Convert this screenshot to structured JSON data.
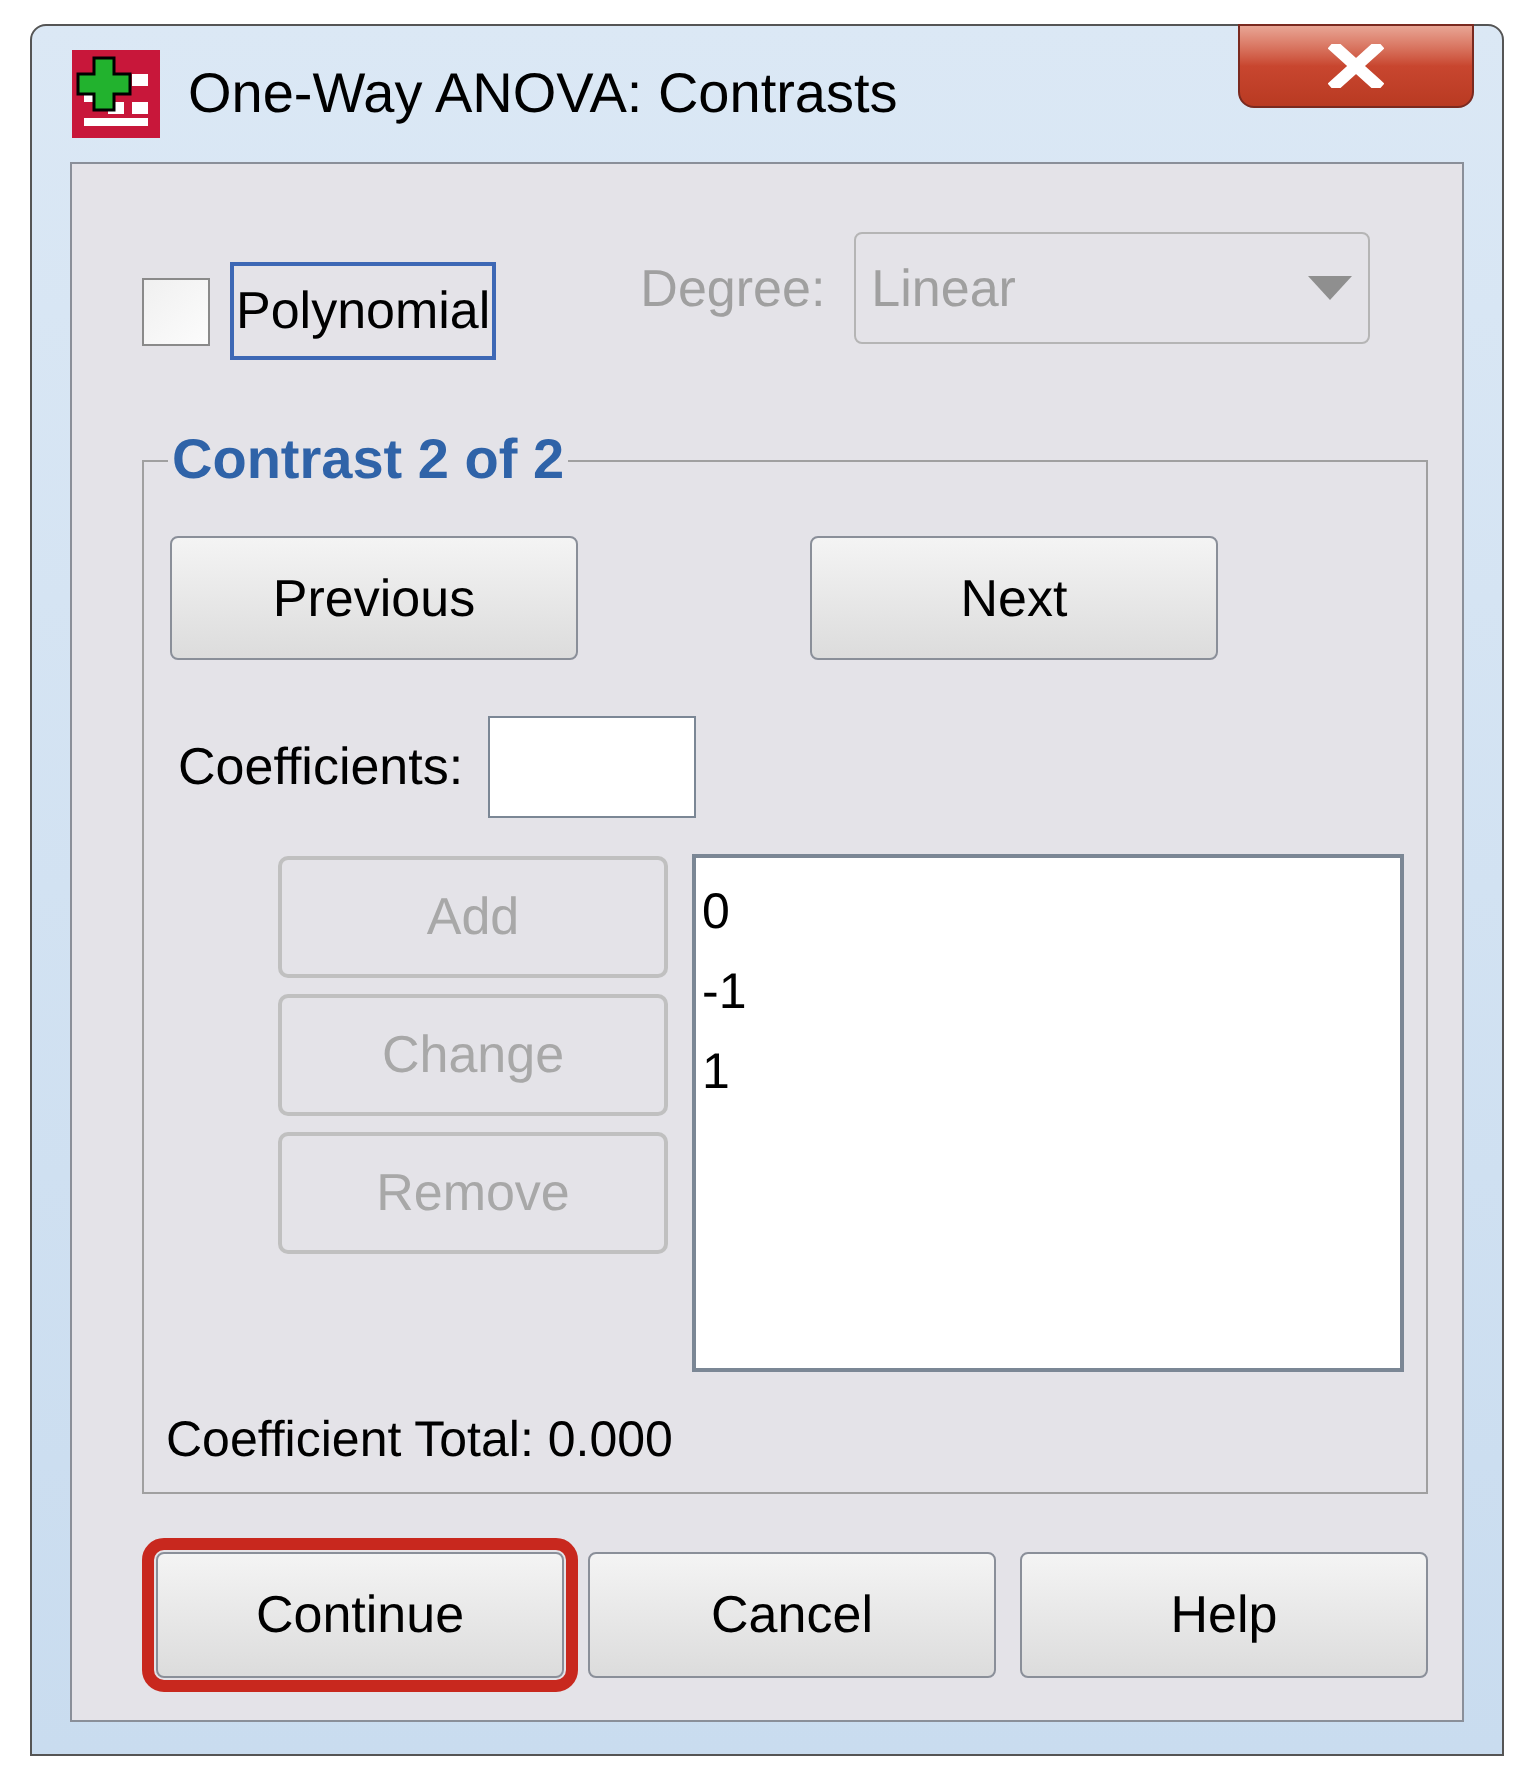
{
  "window": {
    "title": "One-Way ANOVA: Contrasts"
  },
  "polynomial": {
    "label": "Polynomial",
    "checked": false,
    "focused": true
  },
  "degree": {
    "label": "Degree:",
    "value": "Linear",
    "disabled": true
  },
  "contrast_group": {
    "title": "Contrast 2 of 2",
    "nav_buttons": [
      {
        "label": "Previous"
      },
      {
        "label": "Next"
      }
    ],
    "coefficients": {
      "label": "Coefficients:"
    },
    "action_buttons": [
      {
        "label": "Add",
        "disabled": true
      },
      {
        "label": "Change",
        "disabled": true
      },
      {
        "label": "Remove",
        "disabled": true
      }
    ],
    "list_items": [
      "0",
      "-1",
      "1"
    ],
    "total": "Coefficient Total: 0.000"
  },
  "buttons": [
    {
      "label": "Continue",
      "highlighted": true
    },
    {
      "label": "Cancel",
      "highlighted": false
    },
    {
      "label": "Help",
      "highlighted": false
    }
  ]
}
